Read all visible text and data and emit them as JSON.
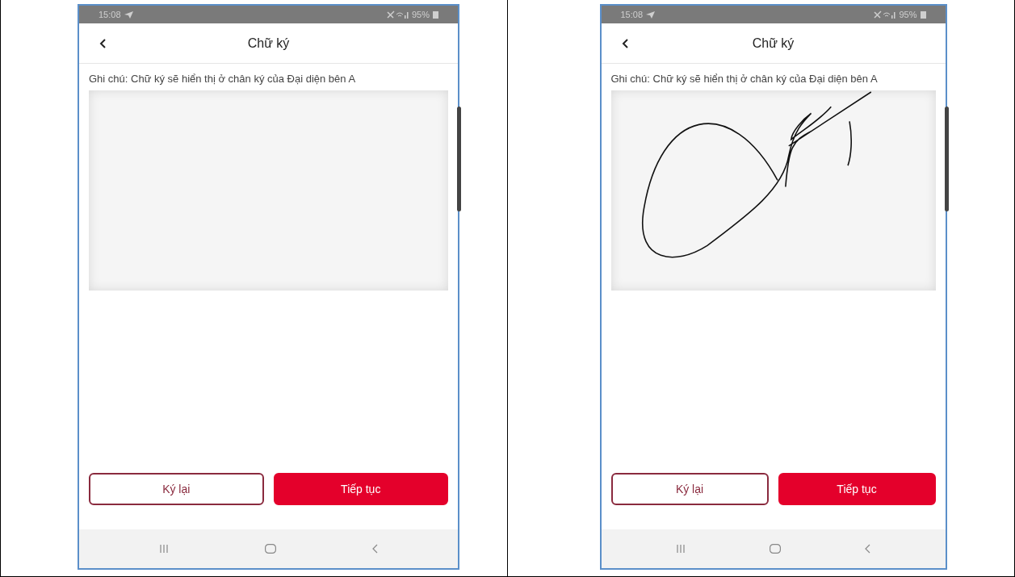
{
  "screens": [
    {
      "status_bar": {
        "time": "15:08",
        "battery": "95%"
      },
      "title": "Chữ ký",
      "note": "Ghi chú: Chữ ký sẽ hiển thị ở chân ký của Đại diện bên A",
      "signed": false,
      "buttons": [
        {
          "label": "Ký lại",
          "kind": "outline"
        },
        {
          "label": "Tiếp tục",
          "kind": "primary"
        }
      ]
    },
    {
      "status_bar": {
        "time": "15:08",
        "battery": "95%"
      },
      "title": "Chữ ký",
      "note": "Ghi chú: Chữ ký sẽ hiển thị ở chân ký của Đại diện bên A",
      "signed": true,
      "buttons": [
        {
          "label": "Ký lại",
          "kind": "outline"
        },
        {
          "label": "Tiếp tục",
          "kind": "primary"
        }
      ]
    }
  ]
}
